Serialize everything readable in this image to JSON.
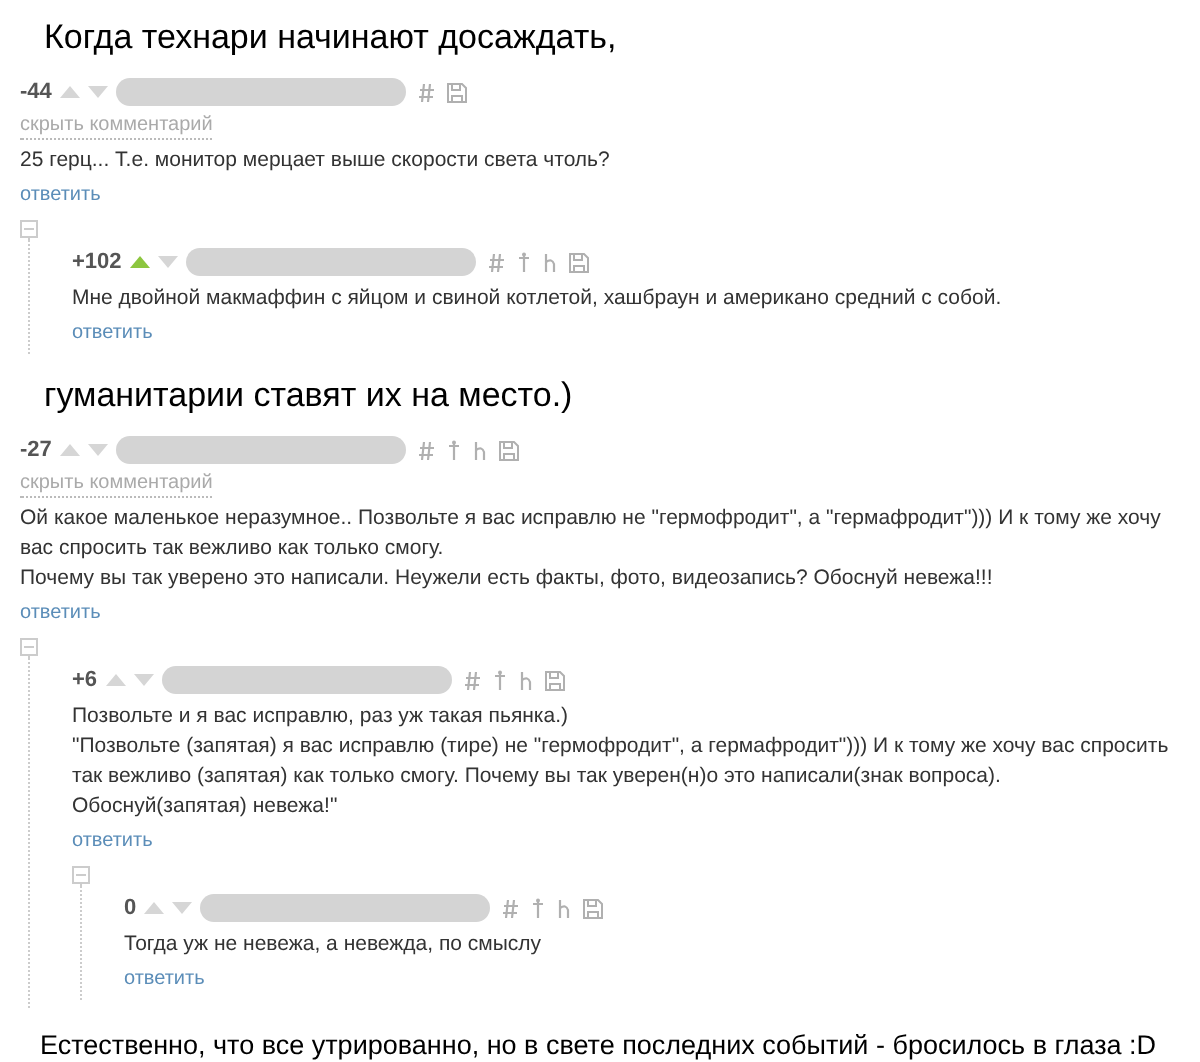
{
  "sections": [
    {
      "kind": "caption",
      "text": "Когда технари начинают досаждать,"
    },
    {
      "kind": "thread",
      "comment": {
        "kind": "basic",
        "score": "-44",
        "upvoted": false,
        "hide_label": "скрыть комментарий",
        "paragraphs": [
          "25 герц... Т.е. монитор мерцает выше скорости света чтоль?"
        ],
        "reply": "ответить",
        "children": [
          {
            "kind": "extended",
            "score": "+102",
            "upvoted": true,
            "paragraphs": [
              "Мне двойной макмаффин с яйцом и свиной котлетой, хашбраун и американо средний с собой."
            ],
            "reply": "ответить"
          }
        ]
      }
    },
    {
      "kind": "caption",
      "text": "гуманитарии ставят их на место.)"
    },
    {
      "kind": "thread",
      "comment": {
        "kind": "extended",
        "score": "-27",
        "upvoted": false,
        "hide_label": "скрыть комментарий",
        "paragraphs": [
          "Ой какое маленькое неразумное.. Позвольте я вас исправлю не \"гермофродит\", а \"гермафродит\"))) И к тому же хочу вас спросить так вежливо как только смогу.",
          "Почему вы так уверено это написали. Неужели есть факты, фото, видеозапись? Обоснуй невежа!!!"
        ],
        "reply": "ответить",
        "children": [
          {
            "kind": "extended",
            "score": "+6",
            "upvoted": false,
            "paragraphs": [
              "Позвольте и я вас исправлю, раз уж такая пьянка.)",
              "\"Позвольте (запятая) я вас исправлю (тире) не \"гермофродит\", а гермафродит\"))) И к тому же хочу вас спросить так вежливо (запятая) как только смогу. Почему вы так уверен(н)о это написали(знак вопроса). Обоснуй(запятая) невежа!\""
            ],
            "reply": "ответить",
            "children": [
              {
                "kind": "extended",
                "score": "0",
                "upvoted": false,
                "paragraphs": [
                  "Тогда уж не невежа, а невежда, по смыслу"
                ],
                "reply": "ответить"
              }
            ]
          }
        ]
      }
    },
    {
      "kind": "caption",
      "text": "Естественно, что все утрированно, но в свете последних событий - бросилось в глаза :D"
    }
  ]
}
